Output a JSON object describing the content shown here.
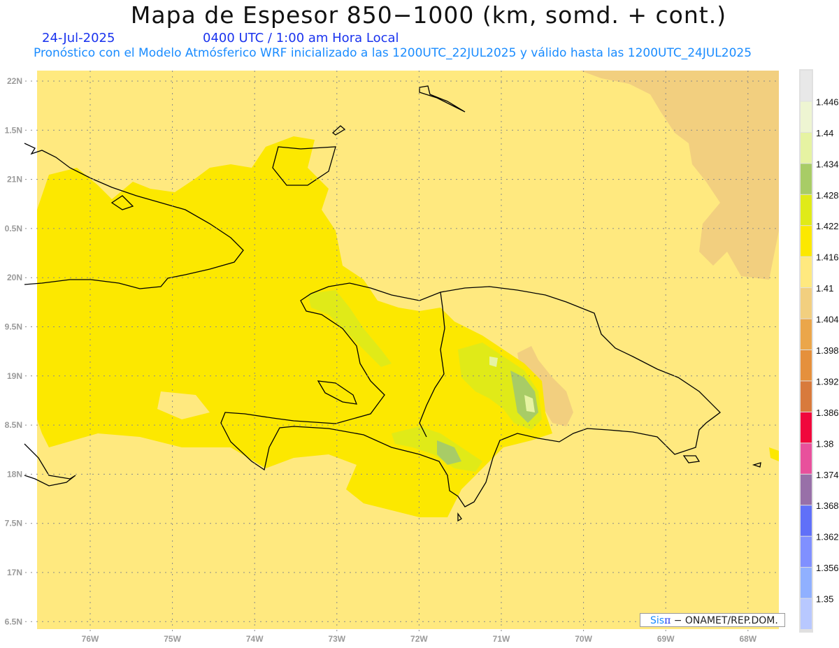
{
  "header": {
    "title": "Mapa de Espesor 850−1000 (km, somd. + cont.)",
    "date": "24-Jul-2025",
    "time": "0400 UTC / 1:00 am Hora Local",
    "subtitle": "Pronóstico con el Modelo Atmósferico WRF inicializado a las 1200UTC_22JUL2025 y válido hasta las  1200UTC_24JUL2025"
  },
  "axes": {
    "lat_labels": [
      "22N",
      "1.5N",
      "21N",
      "0.5N",
      "20N",
      "9.5N",
      "19N",
      "8.5N",
      "18N",
      "7.5N",
      "17N",
      "6.5N"
    ],
    "lon_labels": [
      "76W",
      "75W",
      "74W",
      "73W",
      "72W",
      "71W",
      "70W",
      "69W",
      "68W"
    ]
  },
  "colorbar": {
    "labels": [
      "1.446",
      "1.44",
      "1.434",
      "1.428",
      "1.422",
      "1.416",
      "1.41",
      "1.404",
      "1.398",
      "1.392",
      "1.386",
      "1.38",
      "1.374",
      "1.368",
      "1.362",
      "1.356",
      "1.35"
    ],
    "colors": [
      "#e8e8e8",
      "#eef5d2",
      "#e6f3a2",
      "#a8cc66",
      "#e0ea18",
      "#fce800",
      "#ffe97f",
      "#f2cf7f",
      "#eba64a",
      "#e5903c",
      "#d87a3c",
      "#f0083c",
      "#e8509c",
      "#9870a8",
      "#6070f8",
      "#8090ff",
      "#90b0ff",
      "#b8c8ff"
    ]
  },
  "credit": {
    "sis": "Sis",
    "pi": "π",
    "text": " − ONAMET/REP.DOM."
  },
  "map_colors": {
    "base": "#ffe97f",
    "yellow": "#fce800",
    "tan": "#f2cf7f",
    "lime": "#e0ea18",
    "green": "#a8cc66",
    "pale": "#e6f3a2"
  }
}
